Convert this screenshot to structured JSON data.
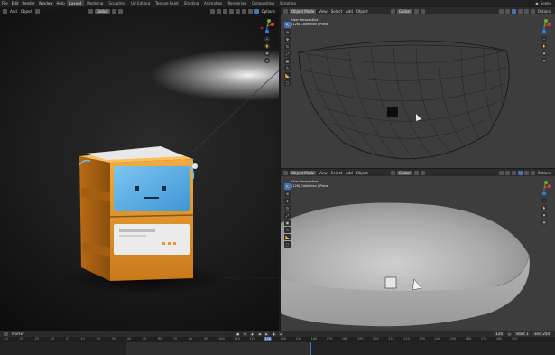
{
  "topbar": {
    "menus": [
      "File",
      "Edit",
      "Render",
      "Window",
      "Help"
    ],
    "workspaces": [
      "Layout",
      "Modeling",
      "Sculpting",
      "UV Editing",
      "Texture Paint",
      "Shading",
      "Animation",
      "Rendering",
      "Compositing",
      "Scripting"
    ],
    "scene_label": "Scene"
  },
  "left_view": {
    "header": {
      "add": "Add",
      "object": "Object",
      "mode": "Global",
      "options": "Options"
    }
  },
  "tr_view": {
    "header": {
      "mode": "Object Mode",
      "view": "View",
      "select": "Select",
      "add": "Add",
      "object": "Object",
      "orientation": "Global",
      "options": "Options"
    },
    "info": {
      "line1": "User Perspective",
      "line2": "(126) Collection | Plane"
    }
  },
  "br_view": {
    "header": {
      "mode": "Object Mode",
      "view": "View",
      "select": "Select",
      "add": "Add",
      "object": "Object",
      "orientation": "Global",
      "options": "Options"
    },
    "info": {
      "line1": "User Perspective",
      "line2": "(126) Collection | Plane"
    }
  },
  "timeline": {
    "label": "Marker",
    "current_frame": "126",
    "start_label": "Start",
    "start": "1",
    "end_label": "End",
    "end": "250",
    "ruler": [
      "-40",
      "-30",
      "-20",
      "-10",
      "0",
      "10",
      "20",
      "30",
      "40",
      "50",
      "60",
      "70",
      "80",
      "90",
      "100",
      "110",
      "120",
      "126",
      "140",
      "150",
      "160",
      "170",
      "180",
      "190",
      "200",
      "210",
      "220",
      "230",
      "240",
      "250",
      "260",
      "270",
      "280",
      "290"
    ]
  },
  "colors": {
    "accent": "#4772b3",
    "axis_x": "#e0393e",
    "axis_y": "#6ab023",
    "axis_z": "#2f83e3",
    "crate_orange": "#e59a2b",
    "screen_blue": "#5aaee3"
  }
}
